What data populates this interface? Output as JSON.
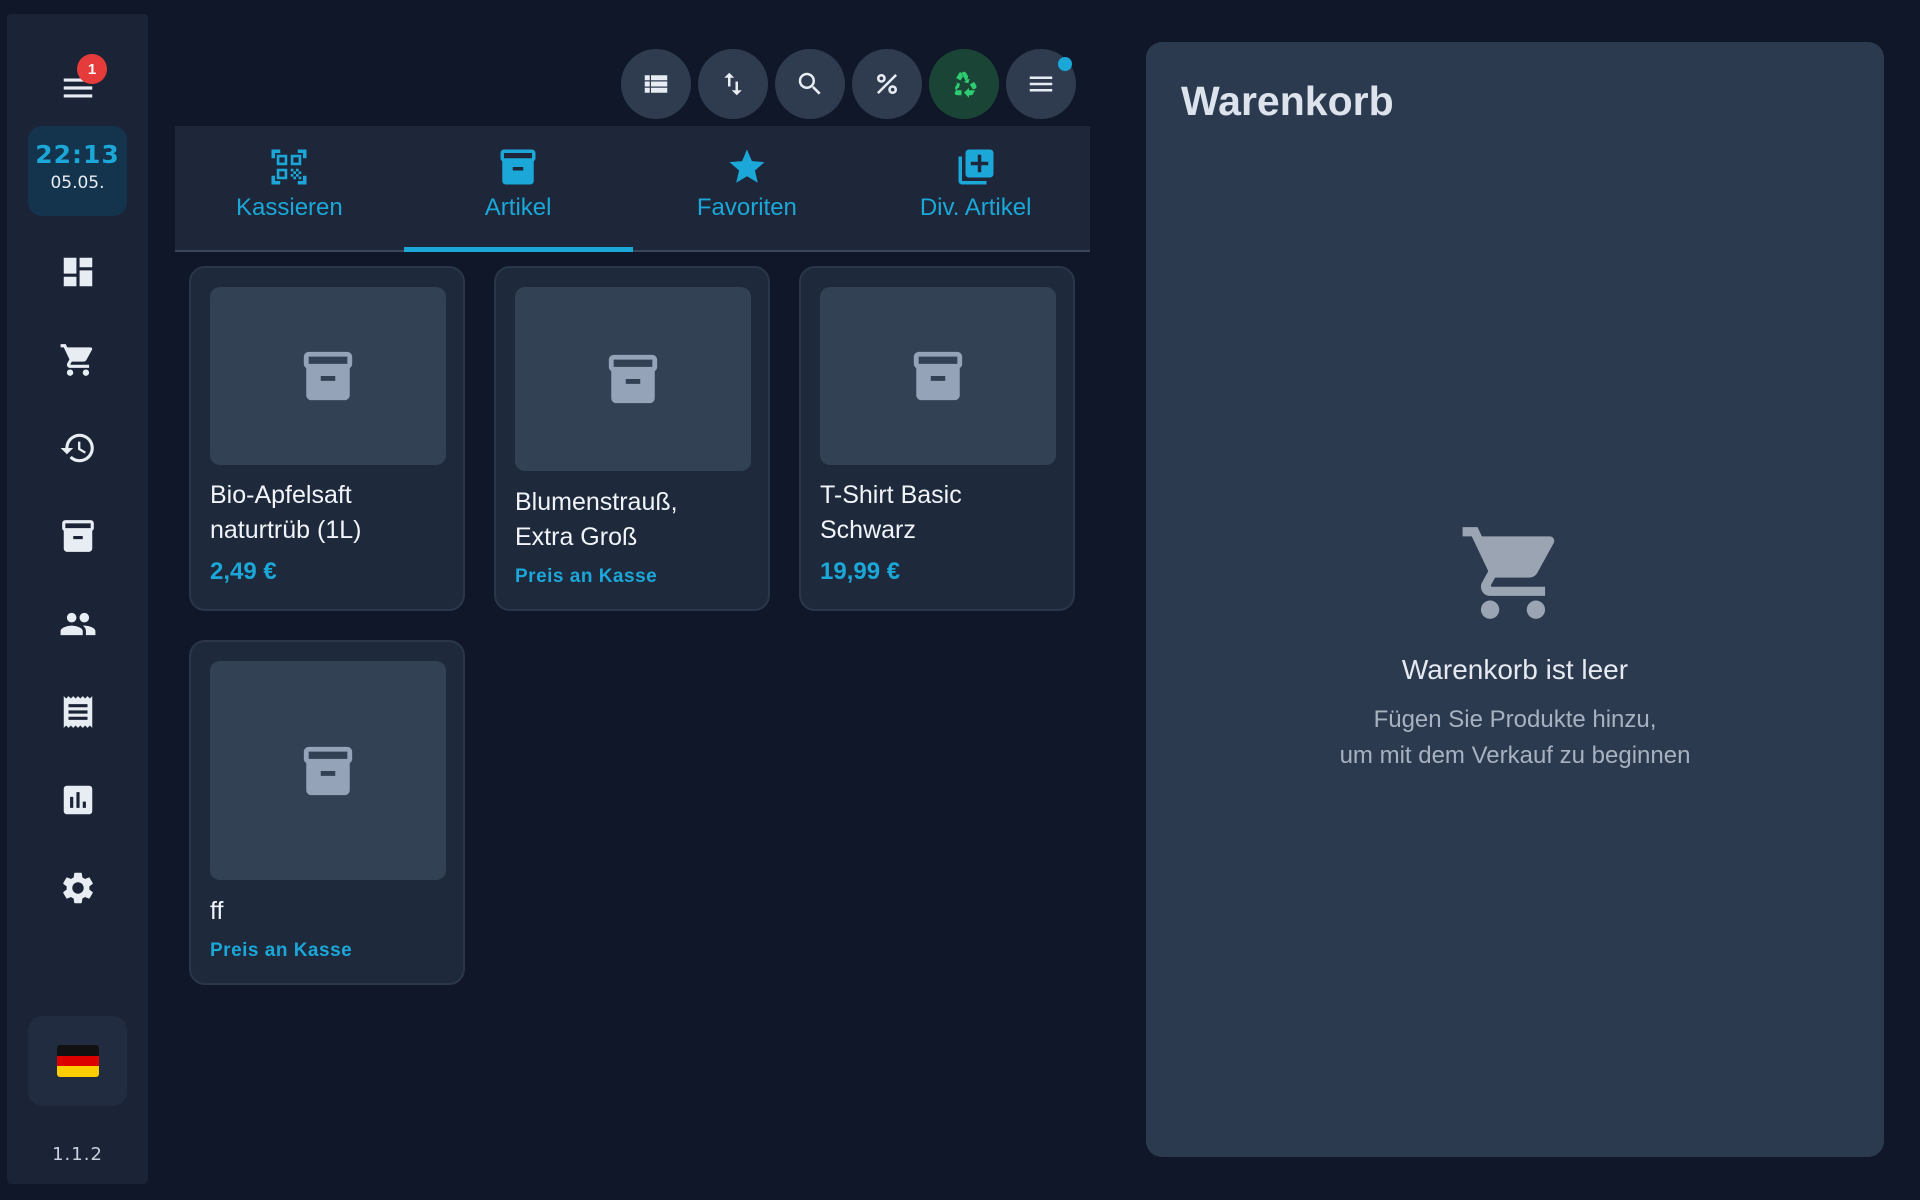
{
  "sidebar": {
    "menu_badge": "1",
    "clock": {
      "time": "22:13",
      "date": "05.05."
    },
    "items": [
      {
        "icon": "dashboard-icon"
      },
      {
        "icon": "cart-icon"
      },
      {
        "icon": "history-icon"
      },
      {
        "icon": "archive-icon"
      },
      {
        "icon": "people-icon"
      },
      {
        "icon": "receipt-icon"
      },
      {
        "icon": "chart-icon"
      },
      {
        "icon": "gear-icon"
      }
    ],
    "language_flag": "flag-de-icon",
    "version": "1.1.2"
  },
  "toolbar": {
    "buttons": [
      "list-view-icon",
      "sort-icon",
      "search-icon",
      "percent-icon",
      "recycle-icon",
      "menu-icon"
    ],
    "accent_color": "#1ba7d8",
    "recycle_color": "#2ecc71"
  },
  "tabs": [
    {
      "label": "Kassieren",
      "icon": "qr-scan-icon"
    },
    {
      "label": "Artikel",
      "icon": "archive-icon",
      "active": true
    },
    {
      "label": "Favoriten",
      "icon": "star-icon"
    },
    {
      "label": "Div. Artikel",
      "icon": "add-box-icon"
    }
  ],
  "products": [
    {
      "name_line1": "Bio-Apfelsaft",
      "name_line2": "naturtrüb (1L)",
      "price": "2,49 €"
    },
    {
      "name_line1": "Blumenstrauß,",
      "name_line2": "Extra Groß",
      "price": "Preis an Kasse"
    },
    {
      "name_line1": "T-Shirt Basic",
      "name_line2": "Schwarz",
      "price": "19,99 €"
    },
    {
      "name_line1": "ff",
      "name_line2": "",
      "price": "Preis an Kasse"
    }
  ],
  "cart": {
    "title": "Warenkorb",
    "empty_title": "Warenkorb ist leer",
    "empty_line1": "Fügen Sie Produkte hinzu,",
    "empty_line2": "um mit dem Verkauf zu beginnen"
  }
}
